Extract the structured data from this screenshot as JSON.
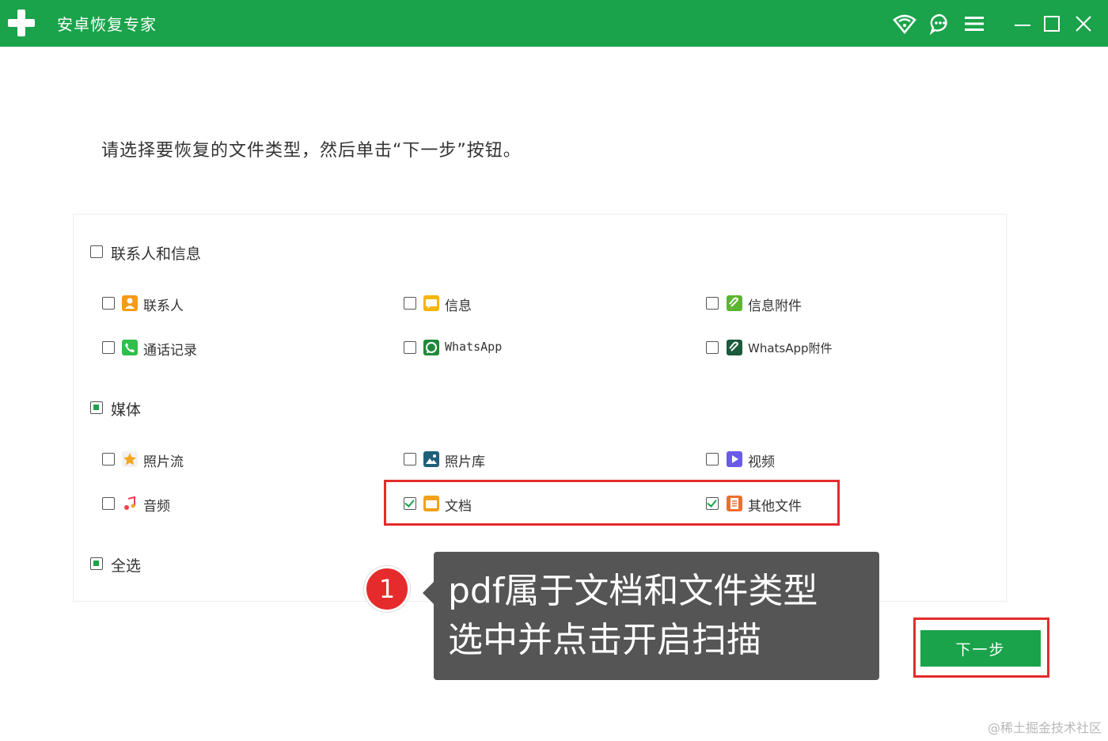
{
  "titlebar": {
    "app_title": "安卓恢复专家",
    "icons": [
      "wifi-icon",
      "chat-icon",
      "menu-icon",
      "minimize-icon",
      "maximize-icon",
      "close-icon"
    ]
  },
  "instruction": "请选择要恢复的文件类型，然后单击“下一步”按钮。",
  "groups": {
    "contacts_messages": {
      "label": "联系人和信息",
      "state": "unchecked",
      "items": [
        {
          "label": "联系人",
          "icon": "contact-icon",
          "checked": false
        },
        {
          "label": "信息",
          "icon": "message-icon",
          "checked": false
        },
        {
          "label": "信息附件",
          "icon": "attachment-icon",
          "checked": false
        },
        {
          "label": "通话记录",
          "icon": "phone-icon",
          "checked": false
        },
        {
          "label": "WhatsApp",
          "icon": "whatsapp-icon",
          "checked": false
        },
        {
          "label": "WhatsApp附件",
          "icon": "whatsapp-attachment-icon",
          "checked": false
        }
      ]
    },
    "media": {
      "label": "媒体",
      "state": "partial",
      "items": [
        {
          "label": "照片流",
          "icon": "photo-stream-icon",
          "checked": false
        },
        {
          "label": "照片库",
          "icon": "photo-library-icon",
          "checked": false
        },
        {
          "label": "视频",
          "icon": "video-icon",
          "checked": false
        },
        {
          "label": "音频",
          "icon": "audio-icon",
          "checked": false
        },
        {
          "label": "文档",
          "icon": "folder-icon",
          "checked": true
        },
        {
          "label": "其他文件",
          "icon": "file-icon",
          "checked": true
        }
      ]
    },
    "select_all": {
      "label": "全选",
      "state": "partial"
    }
  },
  "annotation": {
    "step_number": "1",
    "line1": "pdf属于文档和文件类型",
    "line2": "选中并点击开启扫描"
  },
  "next_button": "下一步",
  "watermark": "@稀土掘金技术社区",
  "colors": {
    "brand_green": "#1aa34a",
    "highlight_red": "#e52b2b",
    "callout_bg": "#555555"
  }
}
